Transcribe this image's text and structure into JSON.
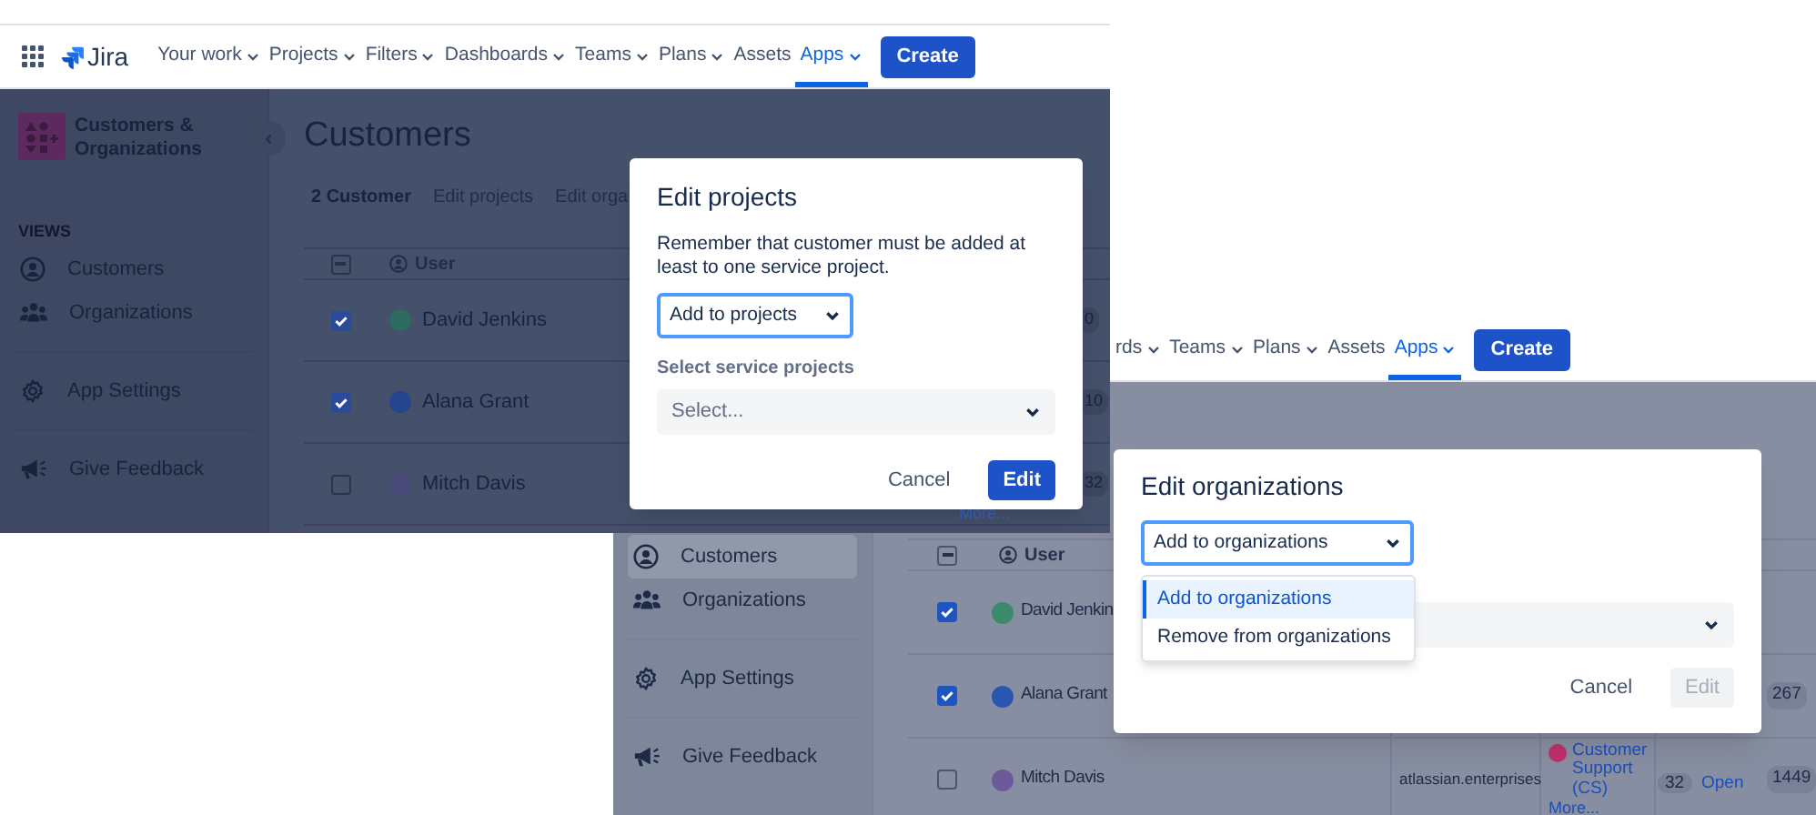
{
  "window_1": {
    "nav": {
      "logo": "Jira",
      "create": "Create",
      "items": [
        {
          "label": "Your work",
          "caret": true,
          "selected": false
        },
        {
          "label": "Projects",
          "caret": true,
          "selected": false
        },
        {
          "label": "Filters",
          "caret": true,
          "selected": false
        },
        {
          "label": "Dashboards",
          "caret": true,
          "selected": false
        },
        {
          "label": "Teams",
          "caret": true,
          "selected": false
        },
        {
          "label": "Plans",
          "caret": true,
          "selected": false
        },
        {
          "label": "Assets",
          "caret": false,
          "selected": false
        },
        {
          "label": "Apps",
          "caret": true,
          "selected": true
        }
      ]
    },
    "sidebar": {
      "title": "Customers & Organizations",
      "section": "VIEWS",
      "groups": [
        {
          "items": [
            {
              "label": "Customers",
              "kind": "person",
              "selected": false
            },
            {
              "label": "Organizations",
              "kind": "people",
              "selected": false
            }
          ]
        },
        {
          "items": [
            {
              "label": "App Settings",
              "kind": "gear",
              "selected": false
            }
          ]
        },
        {
          "items": [
            {
              "label": "Give Feedback",
              "kind": "megaphone",
              "selected": false
            }
          ]
        }
      ]
    },
    "page_title": "Customers",
    "toolbar": {
      "count": "2 Customer",
      "actions": [
        "Edit projects",
        "Edit orga"
      ]
    },
    "table": {
      "columns": [
        {
          "label": "User"
        }
      ],
      "header_indeterminate": true,
      "rows": [
        {
          "user": "David Jenkins",
          "checked": true,
          "color": "#2d6a60",
          "badge": "0"
        },
        {
          "user": "Alana Grant",
          "checked": true,
          "color": "#24468f",
          "badge": "10"
        },
        {
          "user": "Mitch Davis",
          "checked": false,
          "color": "#4a4a7a",
          "badge": "32",
          "more": "More..."
        }
      ]
    },
    "dialog": {
      "title": "Edit projects",
      "description": "Remember that customer must be added at least to one service project.",
      "action": {
        "value": "Add to projects"
      },
      "field": {
        "label": "Select service projects",
        "placeholder": "Select..."
      },
      "buttons": [
        {
          "label": "Cancel",
          "kind": "subtle",
          "disabled": false
        },
        {
          "label": "Edit",
          "kind": "primary",
          "disabled": false
        }
      ]
    }
  },
  "window_2": {
    "nav": {
      "create": "Create",
      "items": [
        {
          "label": "rds",
          "caret": true,
          "selected": false
        },
        {
          "label": "Teams",
          "caret": true,
          "selected": false
        },
        {
          "label": "Plans",
          "caret": true,
          "selected": false
        },
        {
          "label": "Assets",
          "caret": false,
          "selected": false
        },
        {
          "label": "Apps",
          "caret": true,
          "selected": true
        }
      ]
    },
    "sidebar": {
      "groups": [
        {
          "items": [
            {
              "label": "Customers",
              "kind": "person",
              "selected": true
            },
            {
              "label": "Organizations",
              "kind": "people",
              "selected": false
            }
          ]
        },
        {
          "items": [
            {
              "label": "App Settings",
              "kind": "gear",
              "selected": false
            }
          ]
        },
        {
          "items": [
            {
              "label": "Give Feedback",
              "kind": "megaphone",
              "selected": false
            }
          ]
        }
      ]
    },
    "table": {
      "columns": [
        {
          "label": "User"
        }
      ],
      "header_indeterminate": true,
      "rows": [
        {
          "user": "David Jenkin",
          "checked": true,
          "color": "#3c8a6c"
        },
        {
          "user": "Alana Grant",
          "checked": true,
          "color": "#2a55b0",
          "total": "267"
        },
        {
          "user": "Mitch Davis",
          "checked": false,
          "color": "#6a5a9a",
          "domain": "atlassian.enterprises",
          "org": {
            "name": "Customer Support (CS)",
            "color": "#c0306a",
            "more": "More..."
          },
          "count": "32",
          "status": "Open",
          "total": "1449"
        }
      ]
    },
    "dialog": {
      "title": "Edit organizations",
      "action": {
        "value": "Add to organizations",
        "options": [
          {
            "label": "Add to organizations",
            "selected": true
          },
          {
            "label": "Remove from organizations",
            "selected": false
          }
        ]
      },
      "buttons": [
        {
          "label": "Cancel",
          "kind": "subtle",
          "disabled": false
        },
        {
          "label": "Edit",
          "kind": "primary",
          "disabled": true
        }
      ]
    }
  }
}
